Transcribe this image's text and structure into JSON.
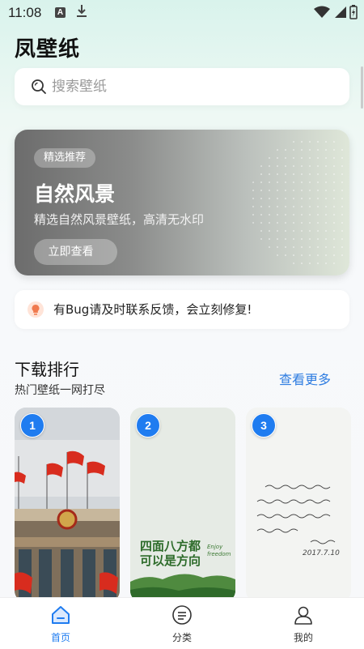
{
  "status_bar": {
    "time": "11:08",
    "a_badge": "A"
  },
  "app": {
    "title": "凤壁纸"
  },
  "search": {
    "placeholder": "搜索壁纸"
  },
  "banner": {
    "tag": "精选推荐",
    "title": "自然风景",
    "subtitle": "精选自然风景壁纸，高清无水印",
    "button": "立即查看"
  },
  "notice": {
    "text": "有Bug请及时联系反馈，会立刻修复!"
  },
  "section": {
    "title": "下载排行",
    "subtitle": "热门壁纸一网打尽",
    "more": "查看更多"
  },
  "cards": [
    {
      "rank": "1"
    },
    {
      "rank": "2",
      "art_text": "四面八方都可以是方向",
      "art_small": "Enjoy freedom"
    },
    {
      "rank": "3",
      "date": "2017.7.10"
    }
  ],
  "tabs": [
    {
      "label": "首页",
      "icon": "home-icon",
      "active": true
    },
    {
      "label": "分类",
      "icon": "category-icon",
      "active": false
    },
    {
      "label": "我的",
      "icon": "user-icon",
      "active": false
    }
  ],
  "colors": {
    "accent": "#1f7cf0",
    "link": "#2f7de1"
  }
}
